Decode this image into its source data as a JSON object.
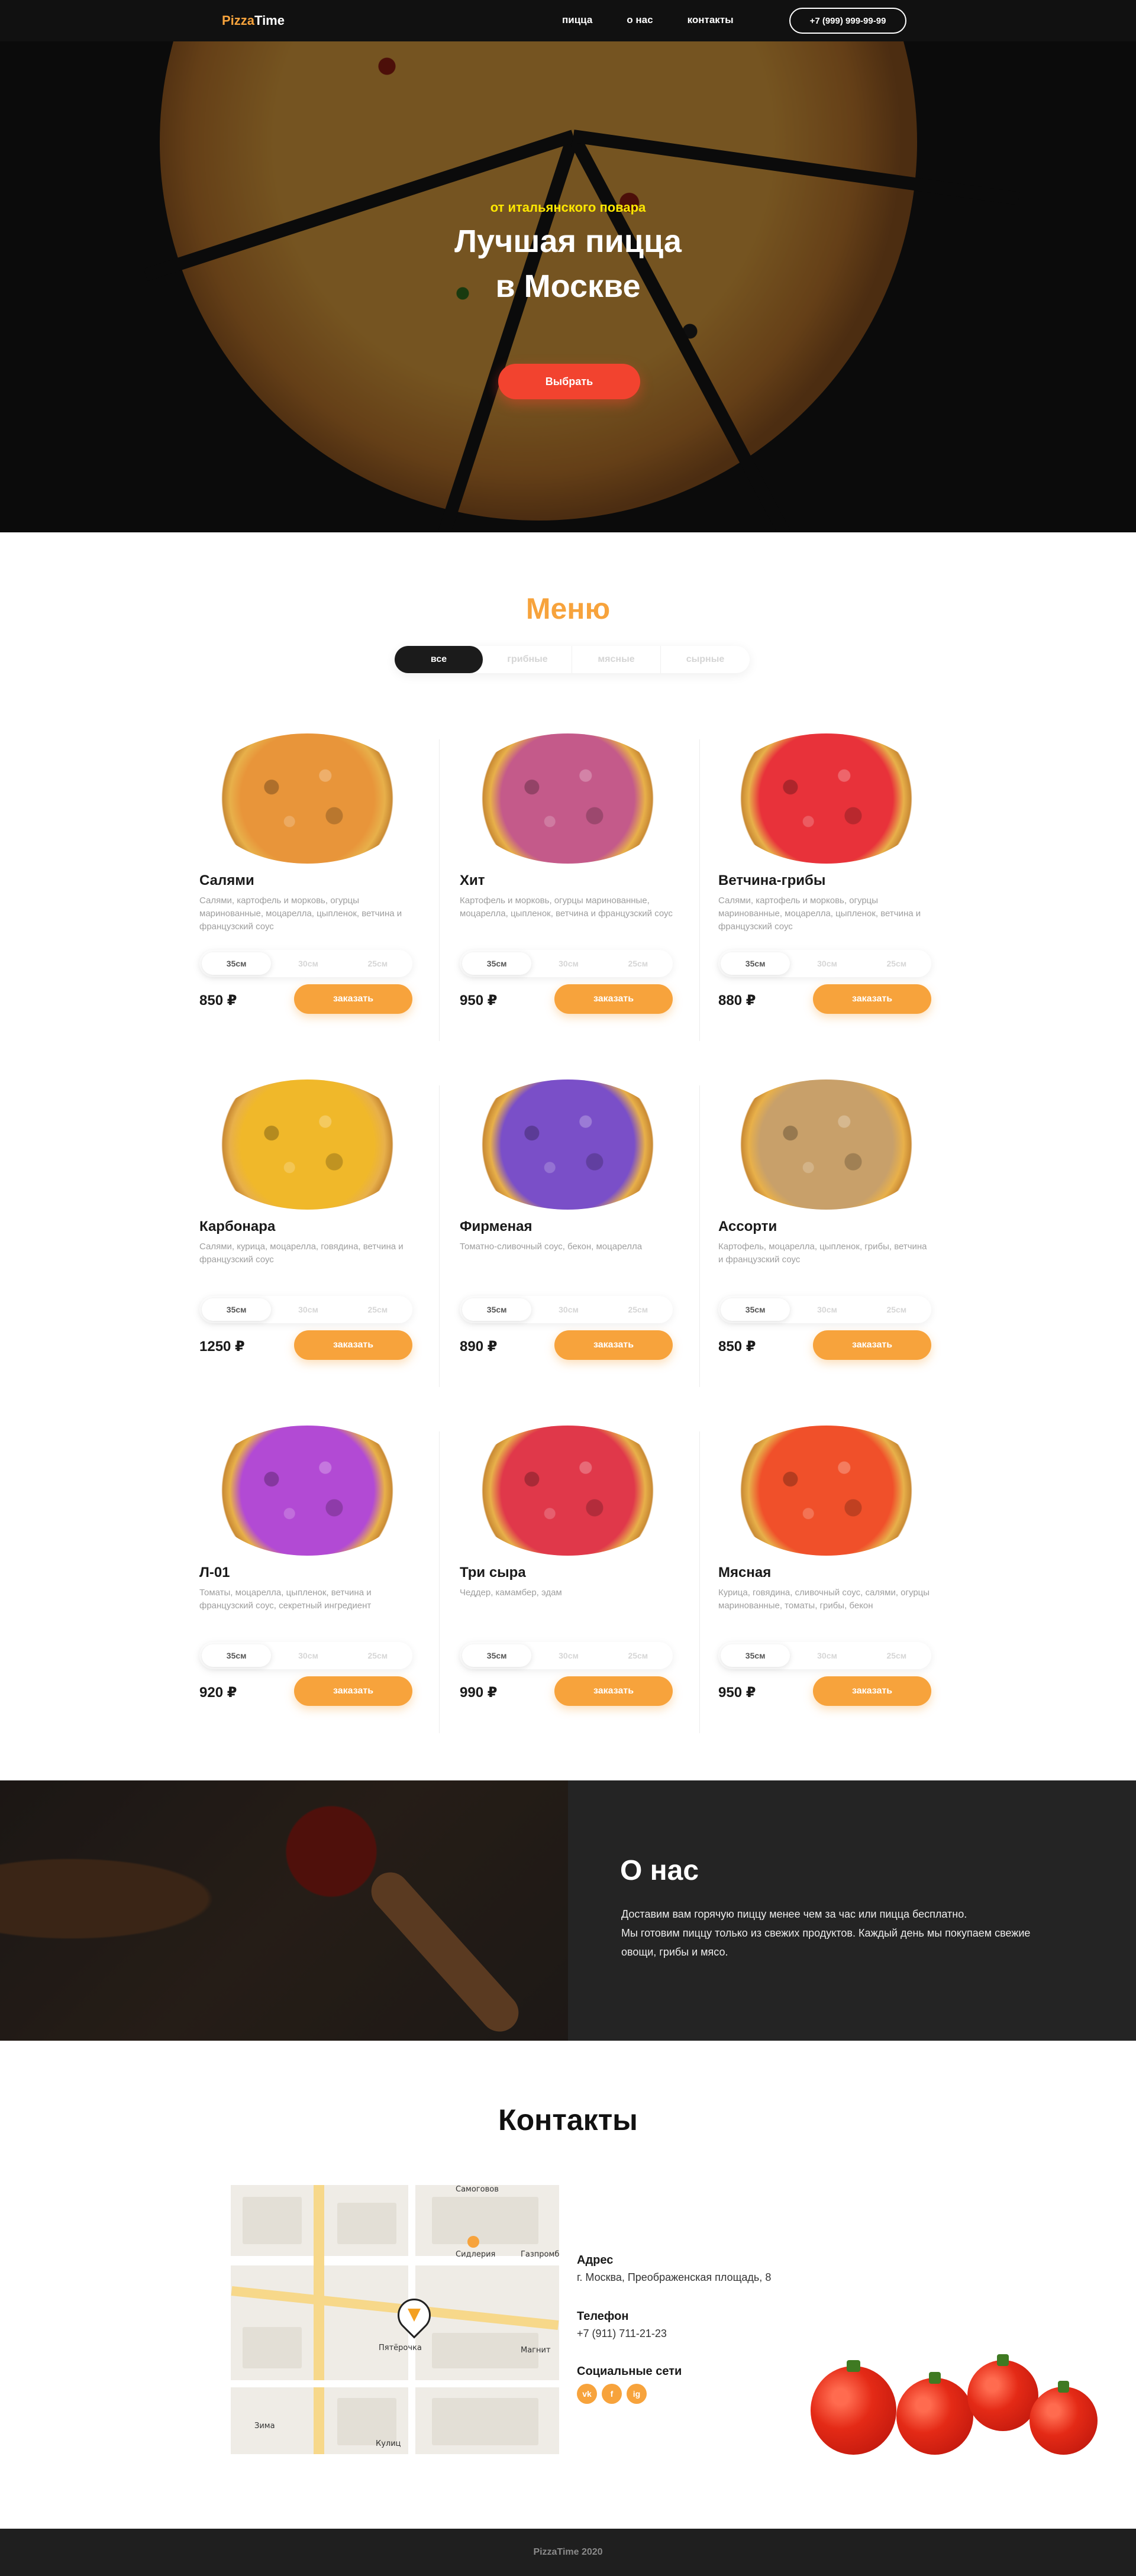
{
  "header": {
    "logo_part1": "Pizza",
    "logo_part2": "Time",
    "nav": [
      "пицца",
      "о нас",
      "контакты"
    ],
    "phone": "+7 (999) 999-99-99"
  },
  "hero": {
    "subtitle": "от итальянского повара",
    "title_line1": "Лучшая пицца",
    "title_line2": "в Москве",
    "button": "Выбрать"
  },
  "menu": {
    "title": "Меню",
    "tabs": [
      "все",
      "грибные",
      "мясные",
      "сырные"
    ],
    "active_tab": "все",
    "currency": "₽",
    "order_label": "заказать",
    "sizes": [
      "35см",
      "30см",
      "25см"
    ],
    "items": [
      {
        "name": "Салями",
        "desc": "Салями, картофель и морковь, огурцы маринованные, моцарелла, цыпленок, ветчина и французский соус",
        "price": "850 ₽",
        "color": "#e8953a"
      },
      {
        "name": "Хит",
        "desc": "Картофель и морковь, огурцы маринованные, моцарелла, цыпленок, ветчина и французский соус",
        "price": "950 ₽",
        "color": "#c45a8a"
      },
      {
        "name": "Ветчина-грибы",
        "desc": "Салями, картофель и морковь, огурцы маринованные, моцарелла, цыпленок, ветчина и французский соус",
        "price": "880 ₽",
        "color": "#e8323a"
      },
      {
        "name": "Карбонара",
        "desc": "Салями, курица, моцарелла, говядина, ветчина и французский соус",
        "price": "1250 ₽",
        "color": "#f0b82a"
      },
      {
        "name": "Фирменая",
        "desc": "Томатно-сливочный соус, бекон, моцарелла",
        "price": "890 ₽",
        "color": "#7a4fc8"
      },
      {
        "name": "Ассорти",
        "desc": "Картофель, моцарелла, цыпленок, грибы, ветчина и французский соус",
        "price": "850 ₽",
        "color": "#c8a06a"
      },
      {
        "name": "Л-01",
        "desc": "Томаты, моцарелла, цыпленок, ветчина и французский соус, секретный ингредиент",
        "price": "920 ₽",
        "color": "#b24ad4"
      },
      {
        "name": "Три сыра",
        "desc": "Чеддер, камамбер, эдам",
        "price": "990 ₽",
        "color": "#e0384a"
      },
      {
        "name": "Мясная",
        "desc": "Курица, говядина, сливочный соус, салями, огурцы маринованные, томаты, грибы, бекон",
        "price": "950 ₽",
        "color": "#f0502a"
      }
    ]
  },
  "about": {
    "title": "О нас",
    "line1": "Доставим вам горячую пиццу менее чем за час или пицца бесплатно.",
    "line2": "Мы готовим пиццу только из свежих продуктов. Каждый день мы покупаем свежие овощи, грибы и мясо."
  },
  "contacts": {
    "title": "Контакты",
    "address_label": "Адрес",
    "address": "г. Москва, Преображенская площадь, 8",
    "phone_label": "Телефон",
    "phone": "+7 (911) 711-21-23",
    "social_label": "Социальные сети",
    "socials": [
      "vk",
      "f",
      "ig"
    ],
    "map_labels": [
      "Самоговов",
      "Сидлерия",
      "Газпромбанк",
      "Пятёрочка",
      "Магнит",
      "Зима",
      "Кулиц"
    ]
  },
  "footer": {
    "text": "PizzaTime 2020"
  }
}
